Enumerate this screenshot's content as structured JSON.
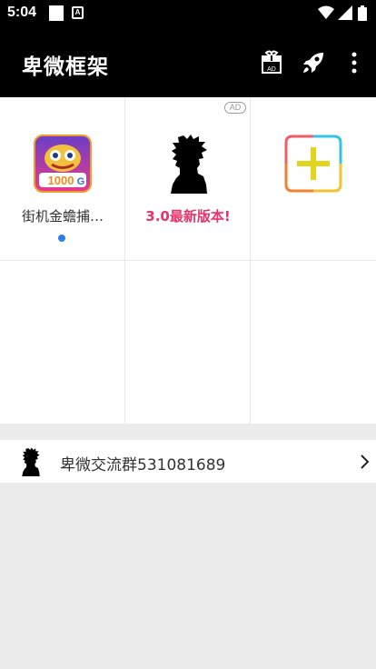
{
  "status_bar": {
    "time": "5:04",
    "notification_icons": [
      "square-notification-icon",
      "a-badge-icon"
    ],
    "system_icons": [
      "wifi-icon",
      "signal-icon",
      "battery-icon"
    ]
  },
  "app_bar": {
    "title": "卑微框架",
    "actions": [
      {
        "icon": "gift-ad-icon",
        "badge": "AD"
      },
      {
        "icon": "rocket-icon"
      },
      {
        "icon": "more-vertical-icon"
      }
    ]
  },
  "grid": {
    "items": [
      {
        "label": "街机金蟾捕…",
        "icon": "game-app-icon",
        "icon_badge": "1000",
        "has_dot": true,
        "dot_color": "#2a7fe8"
      },
      {
        "label": "3.0最新版本!",
        "icon": "silhouette-icon",
        "ad_badge": "AD",
        "label_color": "#e8336a"
      },
      {
        "label": "",
        "icon": "add-app-icon"
      }
    ]
  },
  "group_row": {
    "label": "卑微交流群531081689",
    "icon": "silhouette-icon",
    "chevron": "chevron-right-icon"
  },
  "colors": {
    "accent_blue": "#2a7fe8",
    "accent_red": "#e8336a",
    "appbar_bg": "#000000",
    "page_bg": "#ececec"
  }
}
